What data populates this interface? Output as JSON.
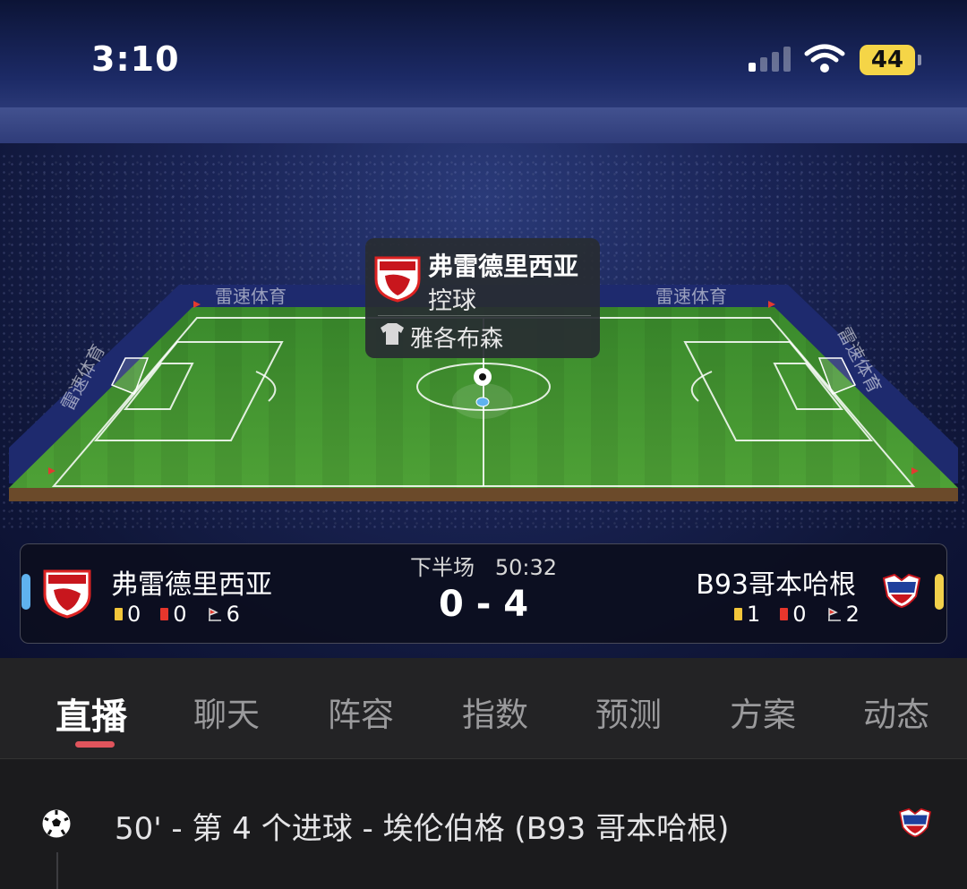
{
  "status_bar": {
    "time": "3:10",
    "battery": "44"
  },
  "pitch": {
    "ad_board_text": "雷速体育"
  },
  "possession_popup": {
    "team": "弗雷德里西亚",
    "status": "控球",
    "player": "雅各布森"
  },
  "match": {
    "period": "下半场",
    "clock": "50:32",
    "score": "0 - 4",
    "home": {
      "name": "弗雷德里西亚",
      "yellow": "0",
      "red": "0",
      "corners": "6",
      "color": "#5fb2ee"
    },
    "away": {
      "name": "B93哥本哈根",
      "yellow": "1",
      "red": "0",
      "corners": "2",
      "color": "#f2d04b"
    }
  },
  "tabs": [
    {
      "label": "直播",
      "active": true
    },
    {
      "label": "聊天"
    },
    {
      "label": "阵容"
    },
    {
      "label": "指数"
    },
    {
      "label": "预测"
    },
    {
      "label": "方案"
    },
    {
      "label": "动态"
    }
  ],
  "events": [
    {
      "text": "50' - 第 4 个进球 - 埃伦伯格 (B93 哥本哈根)",
      "icon": "soccer-ball-icon"
    }
  ]
}
